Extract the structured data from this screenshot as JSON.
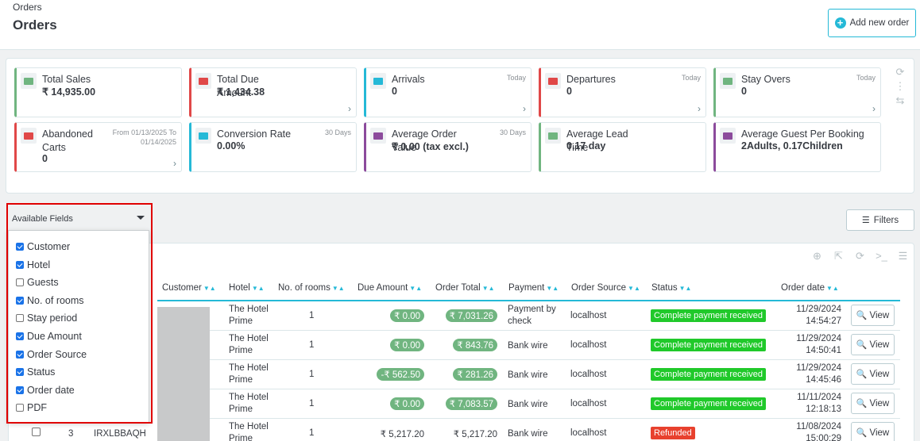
{
  "header": {
    "breadcrumb": "Orders",
    "title": "Orders",
    "add_button": "Add new order"
  },
  "kpis": [
    {
      "label": "Total Sales",
      "value": "₹ 14,935.00",
      "sub": "",
      "color": "#70b580",
      "icon": "money-icon",
      "chevron": false
    },
    {
      "label": "Total Due Amount",
      "value": "₹ 1,434.38",
      "sub": "",
      "color": "#e04848",
      "icon": "money-due-icon",
      "chevron": true
    },
    {
      "label": "Arrivals",
      "value": "0",
      "sub": "Today",
      "color": "#25b9d7",
      "icon": "user-icon",
      "chevron": true
    },
    {
      "label": "Departures",
      "value": "0",
      "sub": "Today",
      "color": "#e04848",
      "icon": "user-icon",
      "chevron": true
    },
    {
      "label": "Stay Overs",
      "value": "0",
      "sub": "Today",
      "color": "#70b580",
      "icon": "user-icon",
      "chevron": true
    },
    {
      "label": "Abandoned Carts",
      "value": "0",
      "sub": "From 01/13/2025 To 01/14/2025",
      "color": "#e04848",
      "icon": "cart-icon",
      "chevron": true
    },
    {
      "label": "Conversion Rate",
      "value": "0.00%",
      "sub": "30 Days",
      "color": "#25b9d7",
      "icon": "sort-icon",
      "chevron": false
    },
    {
      "label": "Average Order Value",
      "value": "₹ 0.00 (tax excl.)",
      "sub": "30 Days",
      "color": "#8c4b9c",
      "icon": "money-icon",
      "chevron": false
    },
    {
      "label": "Average Lead Time",
      "value": "0.17 day",
      "sub": "",
      "color": "#70b580",
      "icon": "clock-icon",
      "chevron": false
    },
    {
      "label": "Average Guest Per Booking",
      "value": "2Adults, 0.17Children",
      "sub": "",
      "color": "#8c4b9c",
      "icon": "users-icon",
      "chevron": false
    }
  ],
  "available_fields": {
    "label": "Available Fields",
    "options": [
      {
        "label": "Customer",
        "checked": true
      },
      {
        "label": "Hotel",
        "checked": true
      },
      {
        "label": "Guests",
        "checked": false
      },
      {
        "label": "No. of rooms",
        "checked": true
      },
      {
        "label": "Stay period",
        "checked": false
      },
      {
        "label": "Due Amount",
        "checked": true
      },
      {
        "label": "Order Source",
        "checked": true
      },
      {
        "label": "Status",
        "checked": true
      },
      {
        "label": "Order date",
        "checked": true
      },
      {
        "label": "PDF",
        "checked": false
      }
    ]
  },
  "filters_button": "Filters",
  "table": {
    "columns": [
      "Customer",
      "Hotel",
      "No. of rooms",
      "Due Amount",
      "Order Total",
      "Payment",
      "Order Source",
      "Status",
      "Order date"
    ],
    "view_label": "View",
    "rows": [
      {
        "hotel": "The Hotel Prime",
        "rooms": "1",
        "due": "₹ 0.00",
        "total": "₹ 7,031.26",
        "payment": "Payment by check",
        "source": "localhost",
        "status": "Complete payment received",
        "status_color": "#20c92a",
        "date": "11/29/2024",
        "time": "14:54:27"
      },
      {
        "hotel": "The Hotel Prime",
        "rooms": "1",
        "due": "₹ 0.00",
        "total": "₹ 843.76",
        "payment": "Bank wire",
        "source": "localhost",
        "status": "Complete payment received",
        "status_color": "#20c92a",
        "date": "11/29/2024",
        "time": "14:50:41"
      },
      {
        "hotel": "The Hotel Prime",
        "rooms": "1",
        "due": "-₹ 562.50",
        "total": "₹ 281.26",
        "payment": "Bank wire",
        "source": "localhost",
        "status": "Complete payment received",
        "status_color": "#20c92a",
        "date": "11/29/2024",
        "time": "14:45:46"
      },
      {
        "hotel": "The Hotel Prime",
        "rooms": "1",
        "due": "₹ 0.00",
        "total": "₹ 7,083.57",
        "payment": "Bank wire",
        "source": "localhost",
        "status": "Complete payment received",
        "status_color": "#20c92a",
        "date": "11/11/2024",
        "time": "12:18:13"
      },
      {
        "id": "3",
        "ref": "IRXLBBAQH",
        "hotel": "The Hotel Prime",
        "rooms": "1",
        "due": "₹ 5,217.20",
        "total": "₹ 5,217.20",
        "payment": "Bank wire",
        "source": "localhost",
        "status": "Refunded",
        "status_color": "#e8412e",
        "date": "11/08/2024",
        "time": "15:00:29"
      }
    ]
  }
}
